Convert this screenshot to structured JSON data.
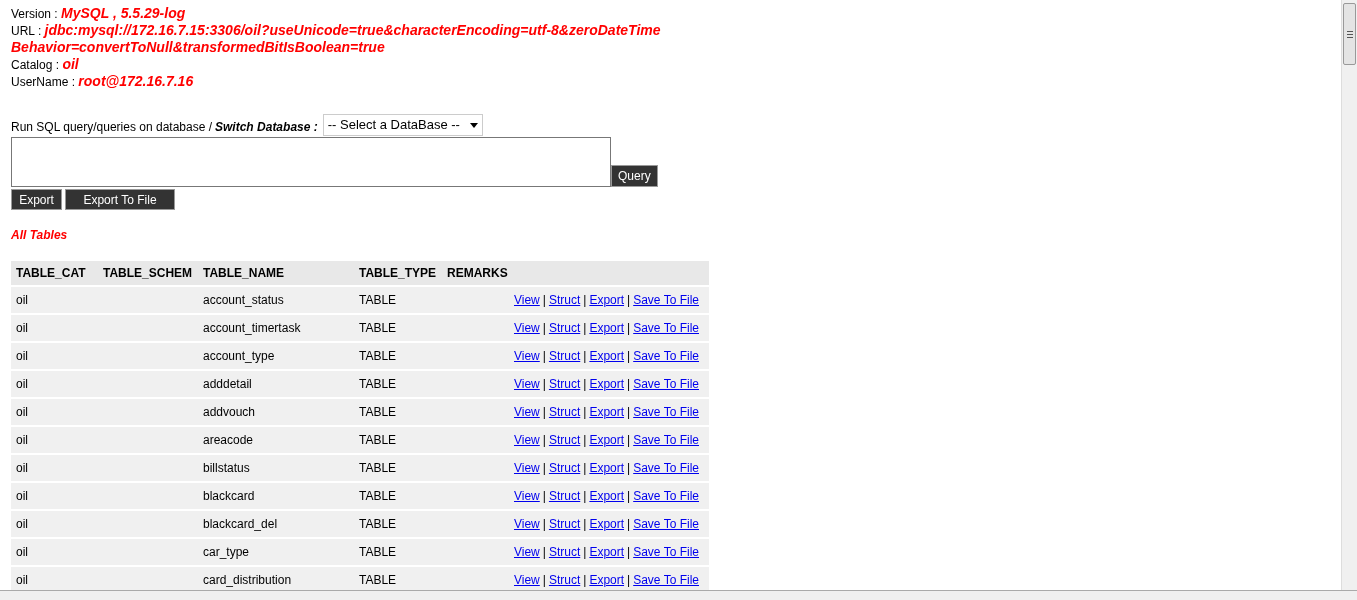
{
  "info": [
    {
      "label": "Version :",
      "value": "MySQL , 5.5.29-log"
    },
    {
      "label": "URL :",
      "value": "jdbc:mysql://172.16.7.15:3306/oil?useUnicode=true&characterEncoding=utf-8&zeroDateTime",
      "continuation": "Behavior=convertToNull&transformedBitIsBoolean=true"
    },
    {
      "label": "Catalog :",
      "value": "oil"
    },
    {
      "label": "UserName :",
      "value": "root@172.16.7.16"
    }
  ],
  "query_form": {
    "prompt": "Run SQL query/queries on database /",
    "switch_label": "Switch Database :",
    "database_select": "-- Select a DataBase --",
    "query_button": "Query",
    "buttons": [
      "Export",
      "Export To File"
    ]
  },
  "section_title": "All Tables",
  "table": {
    "columns": [
      "TABLE_CAT",
      "TABLE_SCHEM",
      "TABLE_NAME",
      "TABLE_TYPE",
      "REMARKS"
    ],
    "rows": [
      {
        "cells": [
          "oil",
          "",
          "account_status",
          "TABLE",
          ""
        ],
        "actions": [
          "View",
          "Struct",
          "Export",
          "Save To File"
        ],
        "separators": [
          "|",
          "|",
          "|"
        ]
      },
      {
        "cells": [
          "oil",
          "",
          "account_timertask",
          "TABLE",
          ""
        ],
        "actions": [
          "View",
          "Struct",
          "Export",
          "Save To File"
        ],
        "separators": [
          "|",
          "|",
          "|"
        ]
      },
      {
        "cells": [
          "oil",
          "",
          "account_type",
          "TABLE",
          ""
        ],
        "actions": [
          "View",
          "Struct",
          "Export",
          "Save To File"
        ],
        "separators": [
          "|",
          "|",
          "|"
        ]
      },
      {
        "cells": [
          "oil",
          "",
          "adddetail",
          "TABLE",
          ""
        ],
        "actions": [
          "View",
          "Struct",
          "Export",
          "Save To File"
        ],
        "separators": [
          "|",
          "|",
          "|"
        ]
      },
      {
        "cells": [
          "oil",
          "",
          "addvouch",
          "TABLE",
          ""
        ],
        "actions": [
          "View",
          "Struct",
          "Export",
          "Save To File"
        ],
        "separators": [
          "|",
          "|",
          "|"
        ]
      },
      {
        "cells": [
          "oil",
          "",
          "areacode",
          "TABLE",
          ""
        ],
        "actions": [
          "View",
          "Struct",
          "Export",
          "Save To File"
        ],
        "separators": [
          "|",
          "|",
          "|"
        ]
      },
      {
        "cells": [
          "oil",
          "",
          "billstatus",
          "TABLE",
          ""
        ],
        "actions": [
          "View",
          "Struct",
          "Export",
          "Save To File"
        ],
        "separators": [
          "|",
          "|",
          "|"
        ]
      },
      {
        "cells": [
          "oil",
          "",
          "blackcard",
          "TABLE",
          ""
        ],
        "actions": [
          "View",
          "Struct",
          "Export",
          "Save To File"
        ],
        "separators": [
          "|",
          "|",
          "|"
        ]
      },
      {
        "cells": [
          "oil",
          "",
          "blackcard_del",
          "TABLE",
          ""
        ],
        "actions": [
          "View",
          "Struct",
          "Export",
          "Save To File"
        ],
        "separators": [
          "|",
          "|",
          "|"
        ]
      },
      {
        "cells": [
          "oil",
          "",
          "car_type",
          "TABLE",
          ""
        ],
        "actions": [
          "View",
          "Struct",
          "Export",
          "Save To File"
        ],
        "separators": [
          "|",
          "|",
          "|"
        ]
      },
      {
        "cells": [
          "oil",
          "",
          "card_distribution",
          "TABLE",
          ""
        ],
        "actions": [
          "View",
          "Struct",
          "Export",
          "Save To File"
        ],
        "separators": [
          "|",
          "|",
          "|"
        ]
      }
    ]
  }
}
